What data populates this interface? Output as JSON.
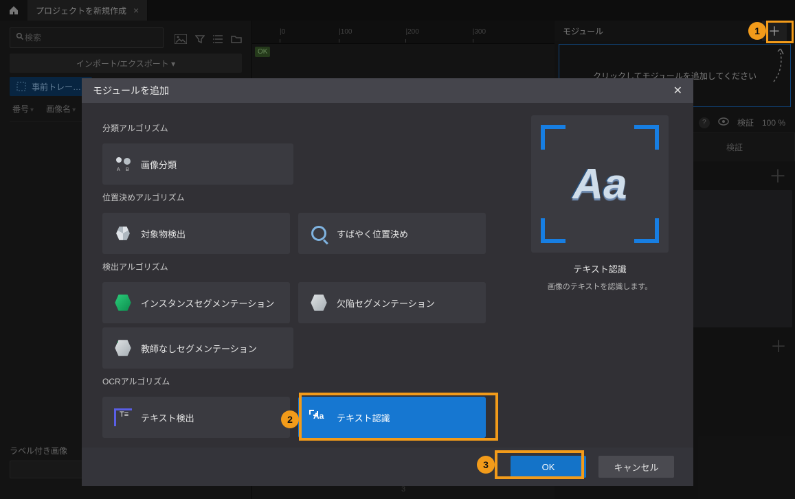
{
  "tab": {
    "title": "プロジェクトを新規作成"
  },
  "left": {
    "search_placeholder": "検索",
    "import_export": "インポート/エクスポート ▾",
    "pretrain": "事前トレー…",
    "col_number": "番号",
    "col_imgname": "画像名",
    "labeled_images": "ラベル付き画像"
  },
  "center": {
    "ok_chip": "OK",
    "ruler": [
      "|0",
      "|100",
      "|200",
      "|300"
    ],
    "bottom_num": "3"
  },
  "right": {
    "header": "モジュール",
    "prompt": "クリックしてモジュールを追加してください",
    "verify_text": "検証",
    "verify_pct": "100 %",
    "tab2": "検証"
  },
  "modal": {
    "title": "モジュールを追加",
    "sections": {
      "classification": {
        "title": "分類アルゴリズム",
        "tiles": [
          "画像分類"
        ]
      },
      "positioning": {
        "title": "位置決めアルゴリズム",
        "tiles": [
          "対象物検出",
          "すばやく位置決め"
        ]
      },
      "detection": {
        "title": "検出アルゴリズム",
        "tiles": [
          "インスタンスセグメンテーション",
          "欠陥セグメンテーション",
          "教師なしセグメンテーション"
        ]
      },
      "ocr": {
        "title": "OCRアルゴリズム",
        "tiles": [
          "テキスト検出",
          "テキスト認識"
        ]
      }
    },
    "preview": {
      "glyph": "Aa",
      "title": "テキスト認識",
      "desc": "画像のテキストを認識します。"
    },
    "ok": "OK",
    "cancel": "キャンセル"
  },
  "callouts": {
    "c1": "1",
    "c2": "2",
    "c3": "3"
  }
}
